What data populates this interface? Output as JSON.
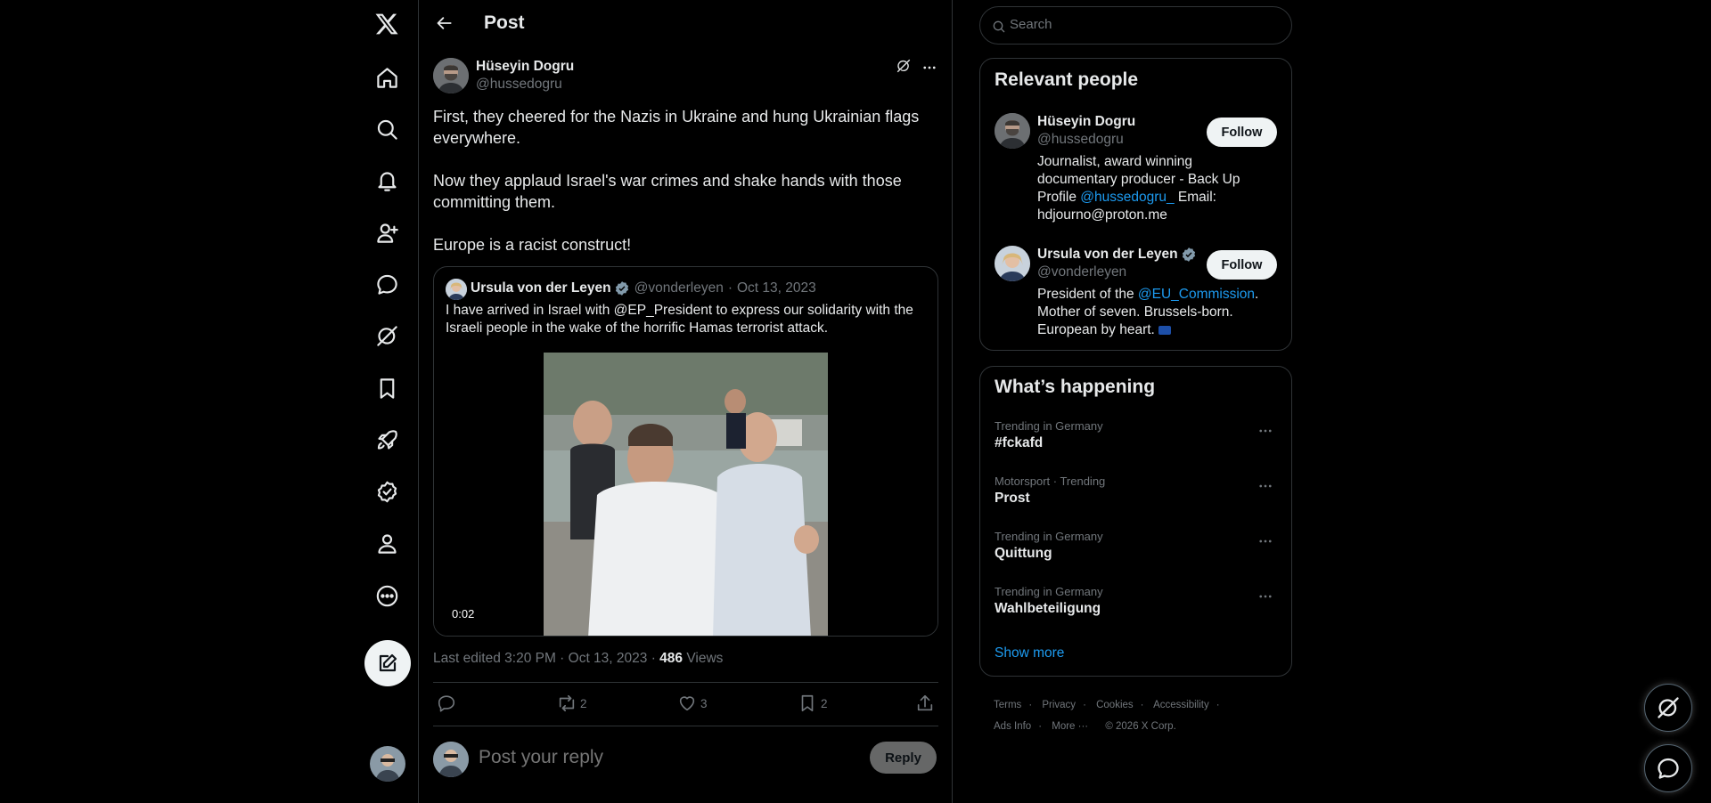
{
  "nav": {
    "items": [
      {
        "name": "x-logo"
      },
      {
        "name": "home"
      },
      {
        "name": "explore"
      },
      {
        "name": "notifications"
      },
      {
        "name": "follow"
      },
      {
        "name": "messages"
      },
      {
        "name": "grok"
      },
      {
        "name": "bookmarks"
      },
      {
        "name": "premium"
      },
      {
        "name": "verified-orgs"
      },
      {
        "name": "profile"
      },
      {
        "name": "more"
      }
    ],
    "compose_icon": "compose-icon"
  },
  "header": {
    "title": "Post"
  },
  "post": {
    "author_name": "Hüseyin Dogru",
    "author_handle": "@hussedogru",
    "paragraphs": [
      "First, they cheered for the Nazis in Ukraine and hung Ukrainian flags everywhere.",
      "Now they applaud Israel's war crimes and shake hands with those committing them.",
      "Europe is a racist construct!"
    ],
    "quote": {
      "name": "Ursula von der Leyen",
      "handle": "@vonderleyen",
      "separator": "·",
      "date": "Oct 13, 2023",
      "text": "I have arrived in Israel with @EP_President to express our solidarity with the Israeli people in the wake of the horrific Hamas terrorist attack.",
      "video_time": "0:02"
    },
    "meta": {
      "edited": "Last edited 3:20 PM · Oct 13, 2023 · ",
      "views_count": "486",
      "views_label": " Views"
    },
    "actions": {
      "replies": "",
      "reposts": "2",
      "likes": "3",
      "bookmarks": "2"
    },
    "reply": {
      "placeholder": "Post your reply",
      "button": "Reply"
    }
  },
  "search": {
    "placeholder": "Search"
  },
  "relevant_people": {
    "title": "Relevant people",
    "people": [
      {
        "name": "Hüseyin Dogru",
        "handle": "@hussedogru",
        "follow": "Follow",
        "bio_1": "Journalist, award winning documentary producer - Back Up Profile ",
        "bio_link": "@hussedogru_",
        "bio_2": " Email: hdjourno@proton.me"
      },
      {
        "name": "Ursula von der Leyen",
        "handle": "@vonderleyen",
        "follow": "Follow",
        "bio_1": "President of the ",
        "bio_link": "@EU_Commission",
        "bio_2": ". Mother of seven. Brussels-born. European by heart."
      }
    ]
  },
  "whats_happening": {
    "title": "What’s happening",
    "trends": [
      {
        "category": "Trending in Germany",
        "name": "#fckafd"
      },
      {
        "category": "Motorsport · Trending",
        "name": "Prost"
      },
      {
        "category": "Trending in Germany",
        "name": "Quittung"
      },
      {
        "category": "Trending in Germany",
        "name": "Wahlbeteiligung"
      }
    ],
    "show_more": "Show more"
  },
  "footer": {
    "links": [
      "Terms",
      "Privacy",
      "Cookies",
      "Accessibility",
      "Ads Info",
      "More ···"
    ],
    "copyright": "© 2026 X Corp."
  },
  "colors": {
    "accent": "#1d9bf0",
    "background": "#000000",
    "border": "#2f3336",
    "muted": "#71767b"
  }
}
